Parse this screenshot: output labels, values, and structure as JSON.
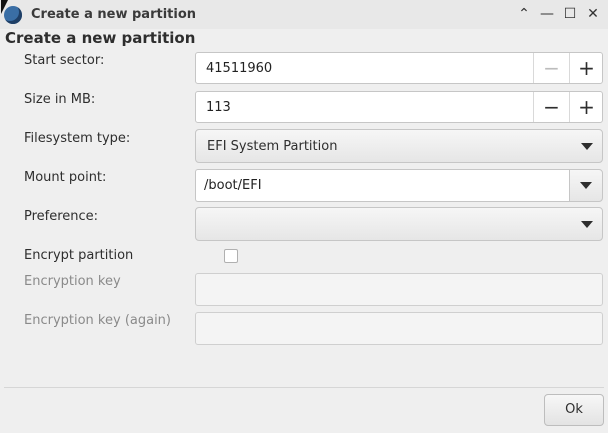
{
  "window": {
    "title": "Create a new partition",
    "controls": [
      "chevron-up-icon",
      "minimize-icon",
      "maximize-icon",
      "close-icon"
    ]
  },
  "heading": "Create a new partition",
  "form": {
    "start_sector": {
      "label": "Start sector:",
      "value": "41511960",
      "decrement_enabled": false,
      "increment_enabled": true
    },
    "size_mb": {
      "label": "Size in MB:",
      "value": "113",
      "decrement_enabled": true,
      "increment_enabled": true
    },
    "filesystem_type": {
      "label": "Filesystem type:",
      "value": "EFI System Partition"
    },
    "mount_point": {
      "label": "Mount point:",
      "value": "/boot/EFI"
    },
    "preference": {
      "label": "Preference:",
      "value": ""
    },
    "encrypt_partition": {
      "label": "Encrypt partition",
      "checked": false
    },
    "encryption_key": {
      "label": "Encryption key",
      "value": "",
      "enabled": false
    },
    "encryption_key_again": {
      "label": "Encryption key (again)",
      "value": "",
      "enabled": false
    }
  },
  "buttons": {
    "ok": "Ok"
  }
}
